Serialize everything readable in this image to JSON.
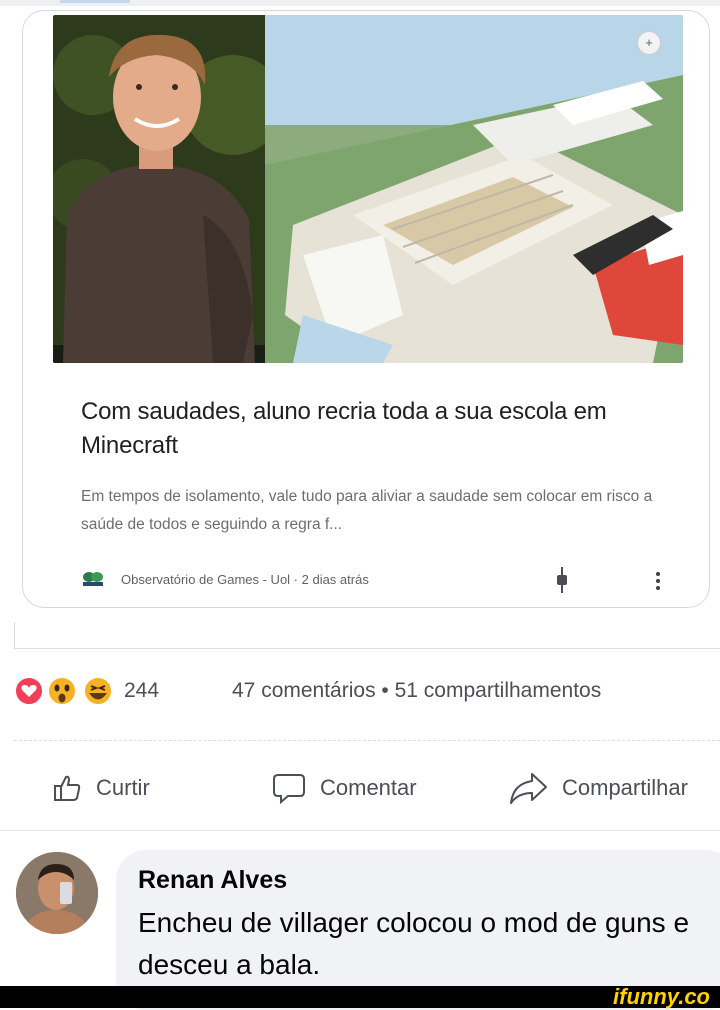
{
  "card": {
    "headline": "Com saudades, aluno recria toda a sua escola em Minecraft",
    "snippet": "Em tempos de isolamento, vale tudo para aliviar a saudade sem colocar em risco a saúde de todos e seguindo a regra f...",
    "source": "Observatório de Games - Uol · 2 dias atrás",
    "more_icon": "plus-icon"
  },
  "post": {
    "reaction_count": "244",
    "meta": "47 comentários • 51 compartilhamentos",
    "reactions": [
      "love",
      "wow",
      "haha"
    ]
  },
  "actions": {
    "like": "Curtir",
    "comment": "Comentar",
    "share": "Compartilhar"
  },
  "comment": {
    "author": "Renan Alves",
    "text": "Encheu de villager colocou o mod de guns e desceu a bala."
  },
  "watermark": "ifunny.co",
  "colors": {
    "love": "#f33e58",
    "emoji": "#f7b125",
    "text_secondary": "#4b4f56"
  }
}
